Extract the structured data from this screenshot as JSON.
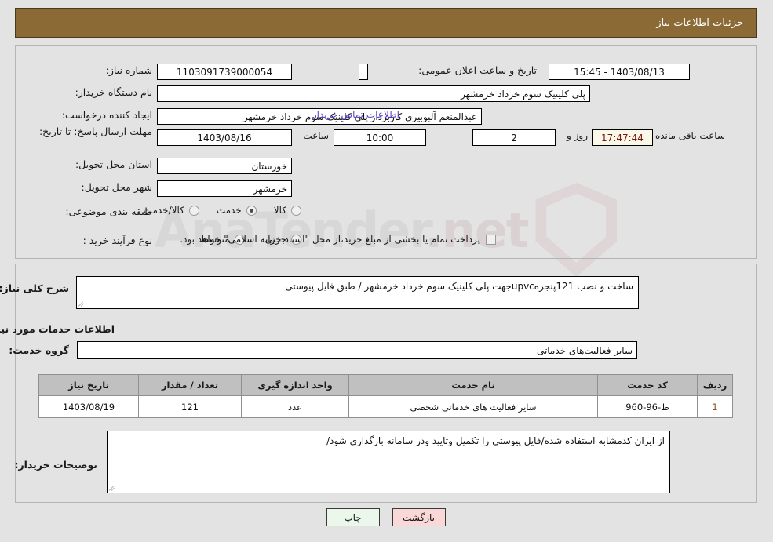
{
  "header": {
    "title": "جزئیات اطلاعات نیاز"
  },
  "form": {
    "need_number_label": "شماره نیاز:",
    "need_number_value": "1103091739000054",
    "announce_datetime_label": "تاریخ و ساعت اعلان عمومی:",
    "announce_datetime_value": "1403/08/13 - 15:45",
    "buyer_org_label": "نام دستگاه خریدار:",
    "buyer_org_value": "پلی کلینیک سوم خرداد خرمشهر",
    "requester_label": "ایجاد کننده درخواست:",
    "requester_value": "عبدالمنعم آلبوبیری کاربرداز پلی کلینیک سوم خرداد خرمشهر",
    "contact_link": "اطلاعات تماس خریدار",
    "deadline_label": "مهلت ارسال پاسخ: تا تاریخ:",
    "deadline_date": "1403/08/16",
    "deadline_time_label": "ساعت",
    "deadline_time": "10:00",
    "remaining_days": "2",
    "days_and_label": "روز و",
    "remaining_timer": "17:47:44",
    "hours_remaining_label": "ساعت باقی مانده",
    "province_label": "استان محل تحویل:",
    "province_value": "خوزستان",
    "city_label": "شهر محل تحویل:",
    "city_value": "خرمشهر",
    "classification_label": "طبقه بندی موضوعی:",
    "classification_options": [
      {
        "label": "کالا",
        "selected": false
      },
      {
        "label": "خدمت",
        "selected": true
      },
      {
        "label": "کالا/خدمت",
        "selected": false
      }
    ],
    "process_type_label": "نوع فرآیند خرید :",
    "process_type_options": [
      {
        "label": "جزیی",
        "selected": false
      },
      {
        "label": "متوسط",
        "selected": false
      }
    ],
    "treasury_checkbox_checked": false,
    "treasury_text": "پرداخت تمام یا بخشی از مبلغ خرید،از محل \"اسناد خزانه اسلامی\" خواهد بود."
  },
  "details": {
    "summary_label": "شرح کلی نیاز:",
    "summary_value": "ساخت و نصب 121پنجرهupvcجهت پلی کلینیک سوم خرداد خرمشهر / طبق فایل پیوستی",
    "services_heading": "اطلاعات خدمات مورد نیاز",
    "service_group_label": "گروه خدمت:",
    "service_group_value": "سایر فعالیت‌های خدماتی",
    "notes_label": "توضیحات خریدار:",
    "notes_value": "از ایران کدمشابه استفاده شده/فایل پیوستی را تکمیل وتایید ودر سامانه بارگذاری شود/"
  },
  "table": {
    "columns": [
      "ردیف",
      "کد خدمت",
      "نام خدمت",
      "واحد اندازه گیری",
      "تعداد / مقدار",
      "تاریخ نیاز"
    ],
    "rows": [
      {
        "row": "1",
        "code": "ط-96-960",
        "name": "سایر فعالیت های خدماتی شخصی",
        "unit": "عدد",
        "qty": "121",
        "date": "1403/08/19"
      }
    ]
  },
  "buttons": {
    "print": "چاپ",
    "back": "بازگشت"
  },
  "watermark": {
    "text": "AnaTender",
    "suffix": ".net"
  }
}
